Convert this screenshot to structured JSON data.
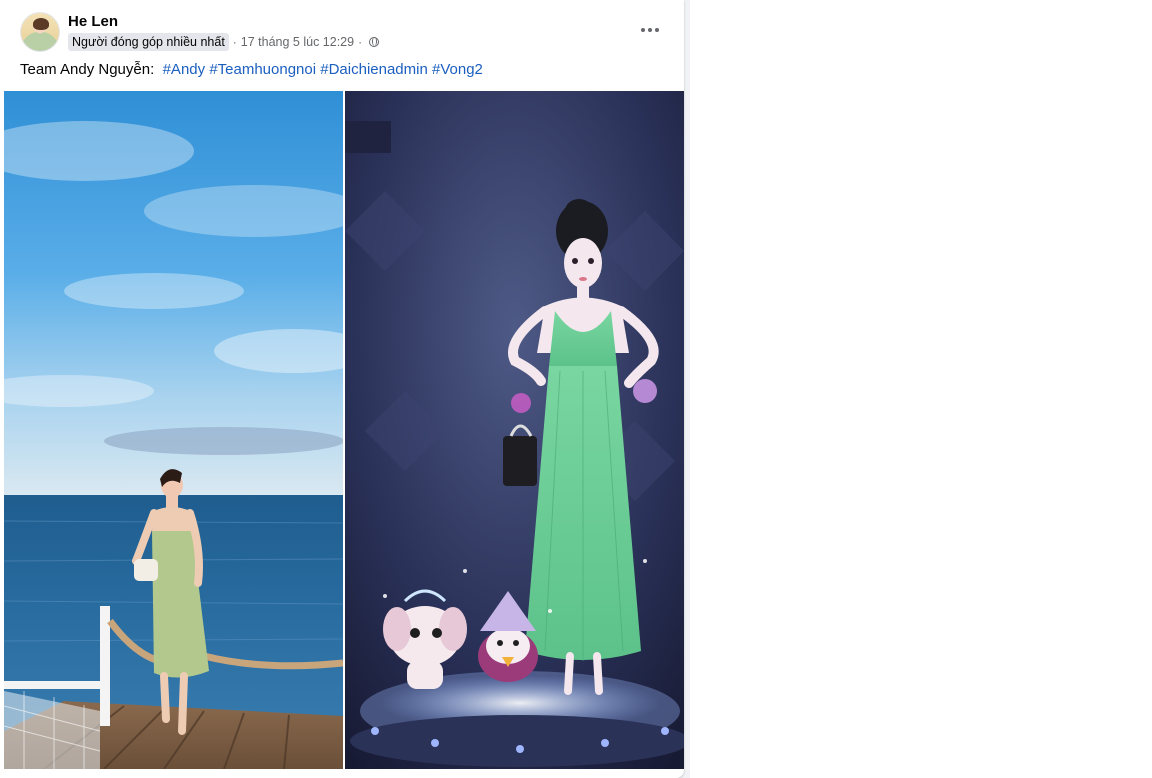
{
  "post": {
    "author": "He Len",
    "badge": "Người đóng góp nhiều nhất",
    "separator": "·",
    "timestamp": "17 tháng 5 lúc 12:29",
    "more_icon": "more-horizontal-icon",
    "privacy_icon": "globe-icon",
    "caption_prefix": "Team Andy Nguyễn:",
    "hashtags": [
      "#Andy",
      "#Teamhuongnoi",
      "#Daichienadmin",
      "#Vong2"
    ]
  },
  "colors": {
    "link": "#1b5fbf",
    "muted": "#65676b",
    "feed_background": "#f0f2f5"
  }
}
